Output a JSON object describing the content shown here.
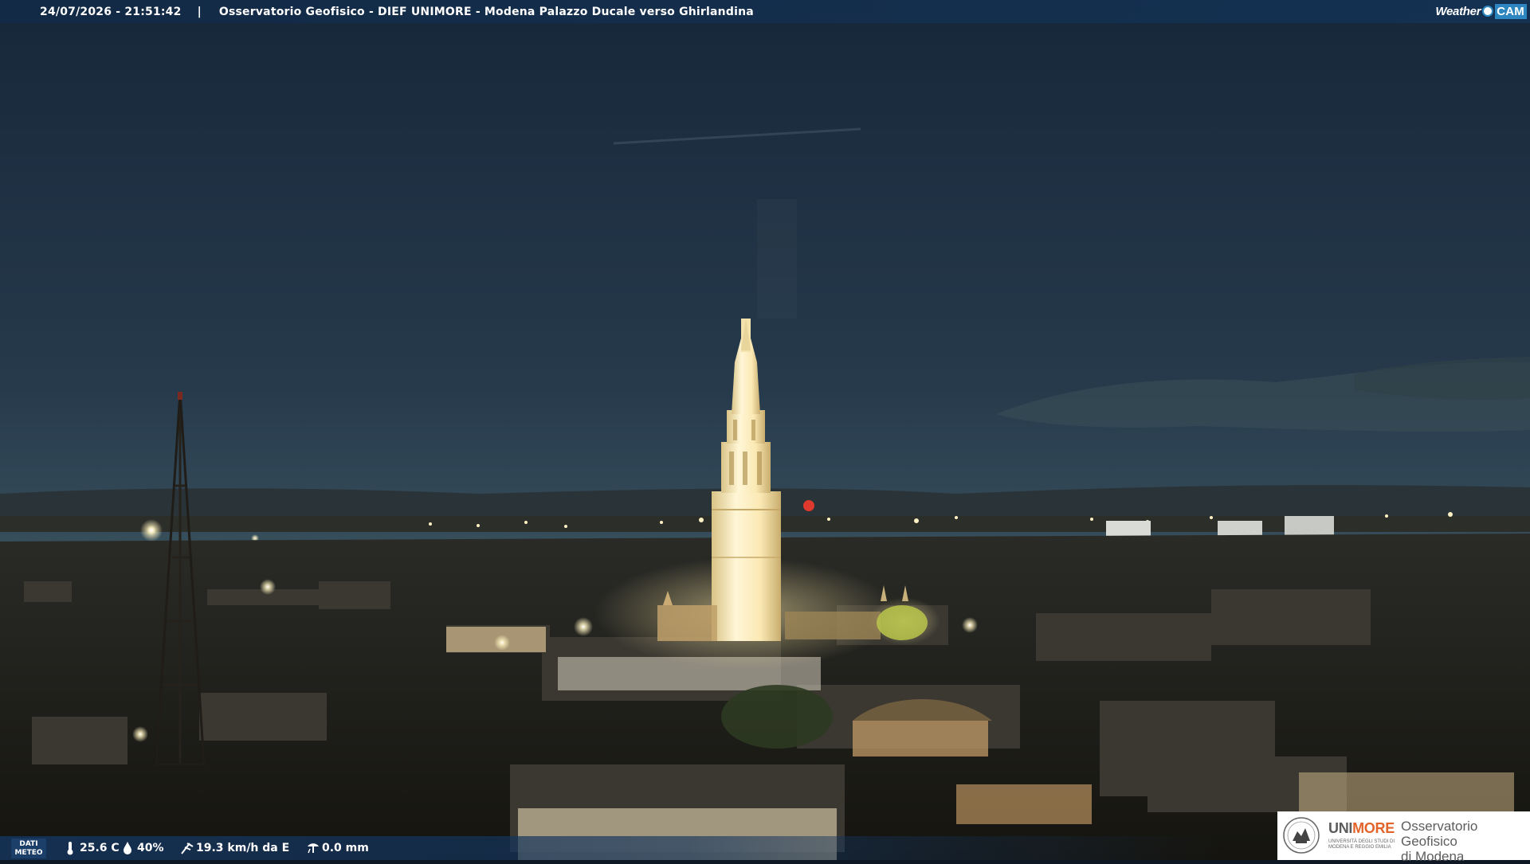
{
  "caption": {
    "timestamp": "24/07/2026 - 21:51:42",
    "separator": "|",
    "title": "Osservatorio Geofisico - DIEF UNIMORE - Modena Palazzo Ducale verso Ghirlandina"
  },
  "brand": {
    "weather": "Weather",
    "cam": "CAM",
    "icon": "weathercam-dot-icon"
  },
  "weather": {
    "label_line1": "DATI",
    "label_line2": "METEO",
    "temperature": "25.6 C",
    "humidity": "40%",
    "wind": "19.3 km/h da E",
    "rain": "0.0 mm"
  },
  "logo": {
    "uni_part1": "UNI",
    "uni_part2": "MORE",
    "university_line1": "UNIVERSITÀ DEGLI STUDI DI",
    "university_line2": "MODENA E REGGIO EMILIA",
    "observatory_line1": "Osservatorio Geofisico",
    "observatory_line2": "di Modena",
    "accent_color": "#e2642b"
  },
  "colors": {
    "sky_top": "#1a2a3c",
    "sky_horizon": "#4f6870",
    "tower_light": "#fff2c8",
    "bar_blue": "#14345c"
  }
}
